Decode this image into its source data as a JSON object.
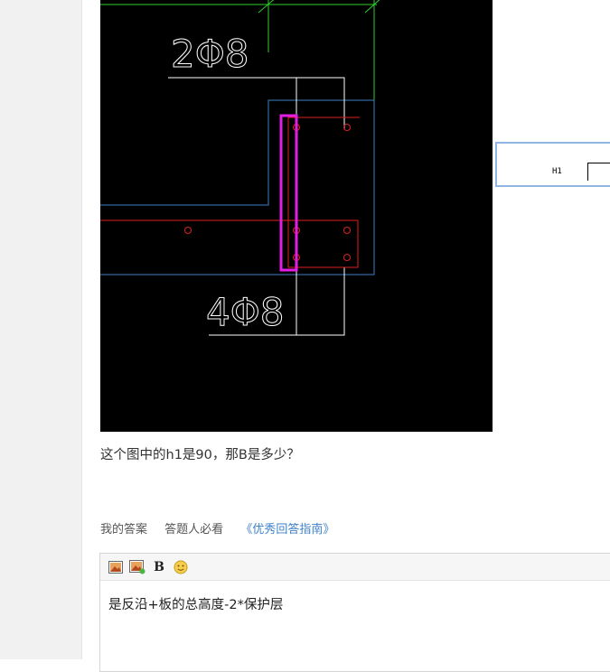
{
  "figure": {
    "top_label": "2Φ8",
    "bottom_label": "4Φ8"
  },
  "side_thumb": {
    "label": "H1"
  },
  "question": {
    "text": "这个图中的h1是90，那B是多少？"
  },
  "answer_nav": {
    "my_answer": "我的答案",
    "must_read": "答题人必看",
    "guide_link": "《优秀回答指南》"
  },
  "editor": {
    "content": "是反沿+板的总高度-2*保护层"
  },
  "colors": {
    "canvas": "#000000",
    "green": "#2bd12b",
    "blue": "#3c7fc8",
    "red": "#e01e1e",
    "magenta": "#e21ee6",
    "white": "#ffffff",
    "link": "#3f82c9"
  }
}
